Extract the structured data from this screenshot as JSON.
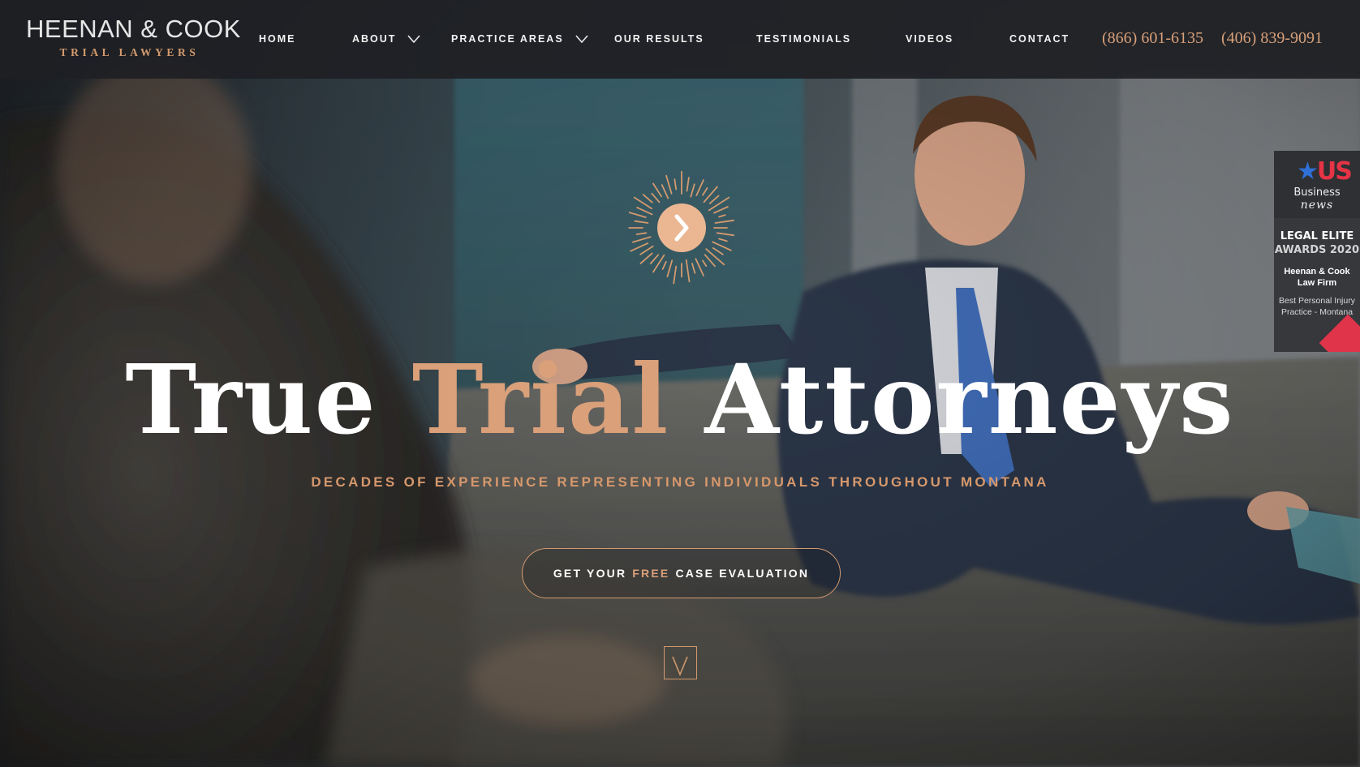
{
  "header": {
    "logo": {
      "name": "HEENAN & COOK",
      "subtitle": "TRIAL LAWYERS"
    },
    "nav": [
      {
        "label": "HOME",
        "has_dropdown": false
      },
      {
        "label": "ABOUT",
        "has_dropdown": true
      },
      {
        "label": "PRACTICE AREAS",
        "has_dropdown": true
      },
      {
        "label": "OUR RESULTS",
        "has_dropdown": false
      },
      {
        "label": "TESTIMONIALS",
        "has_dropdown": false
      },
      {
        "label": "VIDEOS",
        "has_dropdown": false
      },
      {
        "label": "CONTACT",
        "has_dropdown": false
      }
    ],
    "phones": [
      "(866) 601-6135",
      "(406) 839-9091"
    ]
  },
  "hero": {
    "headline_part1": "True",
    "headline_accent": "Trial",
    "headline_part2": "Attorneys",
    "subheadline": "DECADES OF EXPERIENCE REPRESENTING INDIVIDUALS THROUGHOUT MONTANA",
    "cta_prefix": "GET YOUR",
    "cta_accent": "FREE",
    "cta_suffix": "CASE EVALUATION",
    "play_icon": "play-arrow-icon",
    "scroll_icon": "chevron-down-icon"
  },
  "award_badge": {
    "publisher_logo": "US",
    "publisher_line1": "Business",
    "publisher_line2": "news",
    "title_line1": "LEGAL ELITE",
    "title_line2": "AWARDS 2020",
    "firm": "Heenan & Cook Law Firm",
    "description": "Best Personal Injury Practice - Montana"
  },
  "colors": {
    "accent": "#d9a07a",
    "header_bg": "#1e2024",
    "text": "#ffffff"
  }
}
